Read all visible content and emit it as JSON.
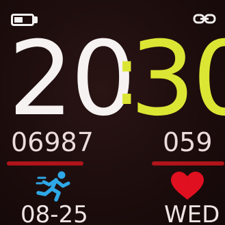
{
  "status": {
    "battery_icon": "battery-icon",
    "connection_icon": "link-icon"
  },
  "time": {
    "hours": "20",
    "separator": ":",
    "minutes": "30"
  },
  "stats": {
    "steps": "06987",
    "heart_rate": "059"
  },
  "icons": {
    "activity": "running-person-icon",
    "heart": "heart-icon"
  },
  "date": {
    "date": "08-25",
    "weekday": "WED"
  },
  "colors": {
    "hours": "#f6f2f2",
    "minutes": "#dbe634",
    "accent_bar": "#b0141a",
    "runner": "#2ea8e6",
    "heart": "#e01020",
    "background": "#1d0d0d"
  }
}
